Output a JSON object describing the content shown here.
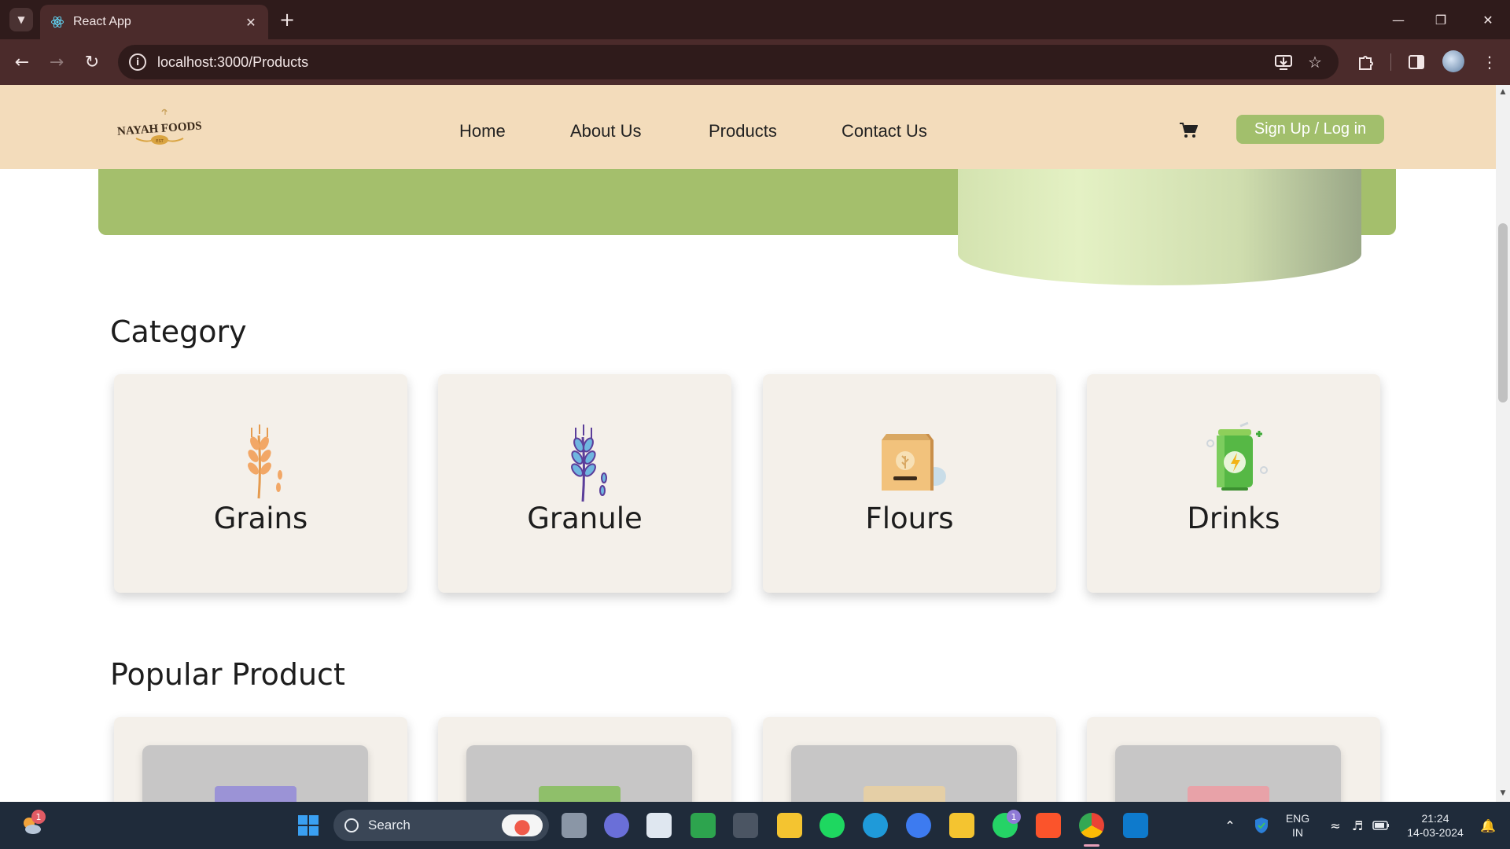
{
  "browser": {
    "tab_title": "React App",
    "url": "localhost:3000/Products",
    "new_tab_symbol": "+"
  },
  "header": {
    "logo_text": "NAYAH FOODS",
    "nav": [
      "Home",
      "About Us",
      "Products",
      "Contact Us"
    ],
    "signup_label": "Sign Up / Log in"
  },
  "category": {
    "title": "Category",
    "items": [
      {
        "label": "Grains",
        "icon": "wheat-icon"
      },
      {
        "label": "Granule",
        "icon": "grain-stalk-icon"
      },
      {
        "label": "Flours",
        "icon": "flour-bag-icon"
      },
      {
        "label": "Drinks",
        "icon": "energy-drink-icon"
      }
    ]
  },
  "popular": {
    "title": "Popular Product",
    "pack_colors": [
      "#9b93d6",
      "#8fbf6a",
      "#e5cfa6",
      "#e8a2a8"
    ]
  },
  "colors": {
    "header_bg": "#f3dcbb",
    "accent_green": "#a2bf6c",
    "card_bg": "#f4f0ea"
  },
  "taskbar": {
    "search_label": "Search",
    "weather_badge": "1",
    "whatsapp_badge": "1",
    "lang_line1": "ENG",
    "lang_line2": "IN",
    "time": "21:24",
    "date": "14-03-2024"
  }
}
